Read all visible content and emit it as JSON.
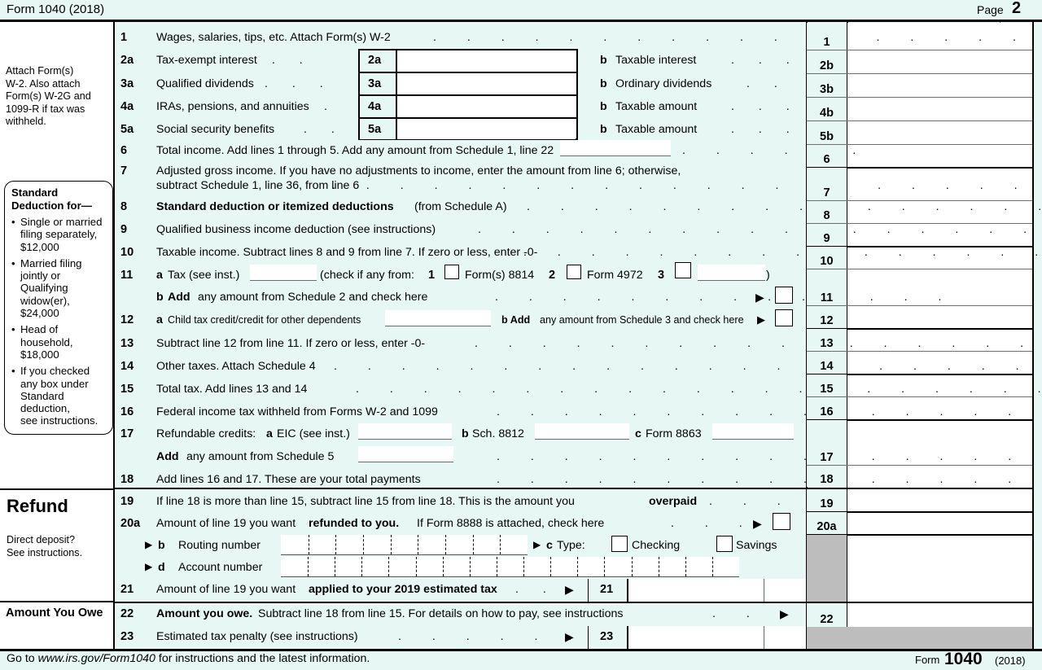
{
  "header": {
    "form_label": "Form 1040 (2018)",
    "page_label": "Page",
    "page_number": "2"
  },
  "colors": {
    "form_bg": "#e6f7f4",
    "field_bg": "#ffffff",
    "shaded": "#bdbdbd",
    "rule": "#000000"
  },
  "sidebar": {
    "attach_note": [
      "Attach Form(s)",
      "W-2. Also attach",
      "Form(s) W-2G and",
      "1099-R if tax was",
      "withheld."
    ],
    "standard_deduction": {
      "title_line1": "Standard",
      "title_line2": "Deduction for—",
      "items": [
        "Single or married filing separately, $12,000",
        "Married filing jointly or Qualifying widow(er), $24,000",
        "Head of household, $18,000",
        "If you checked any box under Standard deduction, see instructions."
      ],
      "items_wrapped": [
        [
          "Single or married",
          "filing separately,",
          "$12,000"
        ],
        [
          "Married filing",
          "jointly or Qualifying",
          "widow(er),",
          "$24,000"
        ],
        [
          "Head of",
          "household,",
          "$18,000"
        ],
        [
          "If you checked",
          "any box under",
          "Standard",
          "deduction,",
          "see instructions."
        ]
      ]
    },
    "refund_heading": "Refund",
    "refund_note": [
      "Direct deposit?",
      "See instructions."
    ],
    "amount_owe_heading": "Amount  You Owe"
  },
  "lines": {
    "l1": {
      "no": "1",
      "text": "Wages, salaries, tips, etc. Attach Form(s) W-2",
      "amount_no": "1"
    },
    "l2a": {
      "no": "2a",
      "text": "Tax-exempt interest",
      "box_label": "2a"
    },
    "l2b": {
      "letter": "b",
      "text": "Taxable interest",
      "amount_no": "2b"
    },
    "l3a": {
      "no": "3a",
      "text": "Qualified dividends",
      "box_label": "3a"
    },
    "l3b": {
      "letter": "b",
      "text": "Ordinary dividends",
      "amount_no": "3b"
    },
    "l4a": {
      "no": "4a",
      "text": "IRAs, pensions, and annuities",
      "box_label": "4a"
    },
    "l4b": {
      "letter": "b",
      "text": "Taxable amount",
      "amount_no": "4b"
    },
    "l5a": {
      "no": "5a",
      "text": "Social security benefits",
      "box_label": "5a"
    },
    "l5b": {
      "letter": "b",
      "text": "Taxable amount",
      "amount_no": "5b"
    },
    "l6": {
      "no": "6",
      "text": "Total income. Add lines 1 through 5. Add any amount from Schedule 1, line 22",
      "amount_no": "6"
    },
    "l7": {
      "no": "7",
      "text_line1": "Adjusted gross income. If you have no adjustments to income, enter the amount from line 6; otherwise,",
      "text_line2": "subtract Schedule 1, line 36, from line 6",
      "amount_no": "7"
    },
    "l8": {
      "no": "8",
      "text_bold": "Standard deduction or itemized deductions",
      "text_rest": "(from Schedule A)",
      "amount_no": "8"
    },
    "l9": {
      "no": "9",
      "text": "Qualified business income deduction (see instructions)",
      "amount_no": "9"
    },
    "l10": {
      "no": "10",
      "text": "Taxable income. Subtract lines 8 and 9 from line 7. If zero or less, enter -0-",
      "amount_no": "10"
    },
    "l11a": {
      "no": "11",
      "letter": "a",
      "text": "Tax (see inst.)",
      "paren_open": "(check if any from:",
      "opt1_num": "1",
      "opt1_label": "Form(s) 8814",
      "opt2_num": "2",
      "opt2_label": "Form 4972",
      "opt3_num": "3",
      "paren_close": ")"
    },
    "l11b": {
      "letter": "b",
      "bold": "Add",
      "text": "any amount from Schedule 2 and check here",
      "amount_no": "11"
    },
    "l12a": {
      "no": "12",
      "letter": "a",
      "text": "Child tax credit/credit for other dependents"
    },
    "l12b": {
      "letter_bold": "b Add",
      "text": "any amount from Schedule 3 and check here",
      "amount_no": "12"
    },
    "l13": {
      "no": "13",
      "text": "Subtract line 12 from line 11. If zero or less, enter -0-",
      "amount_no": "13"
    },
    "l14": {
      "no": "14",
      "text": "Other taxes. Attach Schedule 4",
      "amount_no": "14"
    },
    "l15": {
      "no": "15",
      "text": "Total tax. Add lines 13 and 14",
      "amount_no": "15"
    },
    "l16": {
      "no": "16",
      "text": "Federal income tax withheld from Forms W-2 and 1099",
      "amount_no": "16"
    },
    "l17": {
      "no": "17",
      "label": "Refundable credits:",
      "a_letter": "a",
      "a_text": "EIC (see inst.)",
      "b_letter": "b",
      "b_text": "Sch. 8812",
      "c_letter": "c",
      "c_text": "Form 8863",
      "add_bold": "Add",
      "add_text": "any amount from Schedule 5",
      "amount_no": "17"
    },
    "l18": {
      "no": "18",
      "text": "Add lines 16 and 17. These are your total payments",
      "amount_no": "18"
    },
    "l19": {
      "no": "19",
      "text_pre": "If line 18 is more than line 15, subtract line 15 from line 18. This is the amount you",
      "text_bold": "overpaid",
      "amount_no": "19"
    },
    "l20a": {
      "no": "20a",
      "text_pre": "Amount of line 19 you want",
      "text_bold": "refunded to you.",
      "text_post": "If Form 8888 is attached, check here",
      "amount_no": "20a"
    },
    "l20b": {
      "letter": "b",
      "text": "Routing number",
      "cells": 9
    },
    "l20c": {
      "letter": "c",
      "text": "Type:",
      "opt_checking": "Checking",
      "opt_savings": "Savings"
    },
    "l20d": {
      "letter": "d",
      "text": "Account number",
      "cells": 17
    },
    "l21": {
      "no": "21",
      "text_pre": "Amount of line 19 you want",
      "text_bold": "applied to your 2019 estimated tax",
      "box_label": "21"
    },
    "l22": {
      "no": "22",
      "text_bold": "Amount you owe.",
      "text_rest": "Subtract line 18 from line 15. For details on how to pay, see instructions",
      "amount_no": "22"
    },
    "l23": {
      "no": "23",
      "text": "Estimated tax penalty (see instructions)",
      "box_label": "23"
    }
  },
  "footer": {
    "goto_pre": "Go to",
    "goto_url": "www.irs.gov/Form1040",
    "goto_post": "for instructions and the latest information.",
    "form_word": "Form",
    "form_number": "1040",
    "form_year": "(2018)"
  }
}
